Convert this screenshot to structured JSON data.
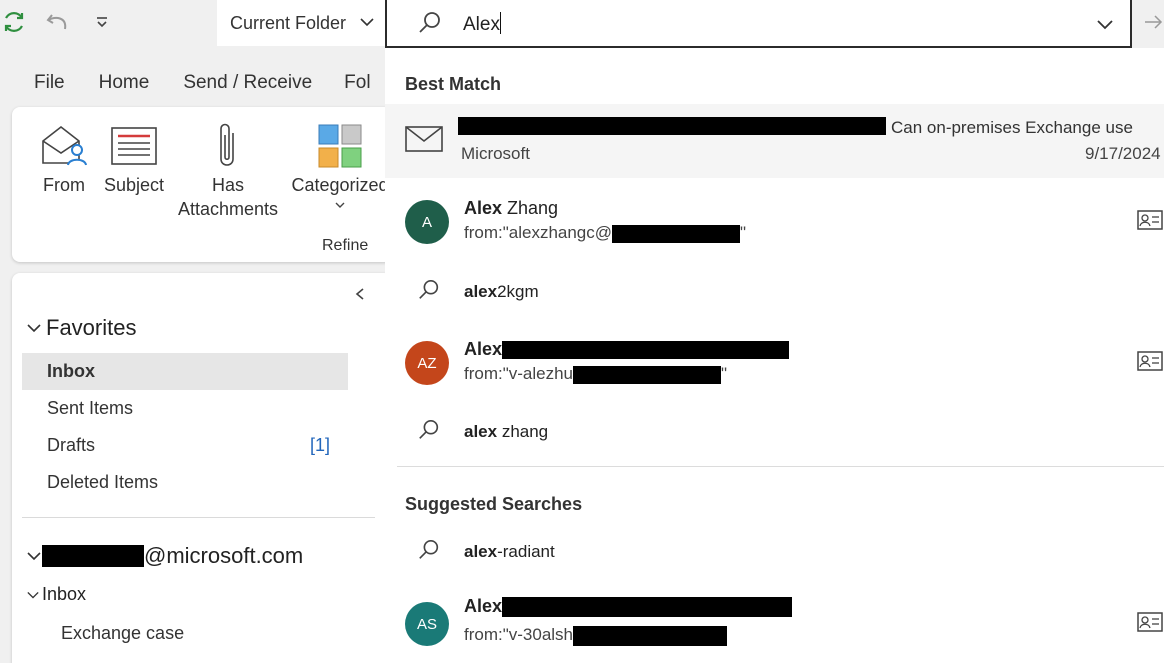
{
  "search": {
    "scope_label": "Current Folder",
    "query": "Alex"
  },
  "ribbon": {
    "tabs": [
      "File",
      "Home",
      "Send / Receive",
      "Fol"
    ],
    "buttons": [
      {
        "label": "From",
        "icon": "envelope-person-icon"
      },
      {
        "label": "Subject",
        "icon": "subject-lines-icon"
      },
      {
        "label": "Has\nAttachments",
        "icon": "paperclip-icon"
      },
      {
        "label": "Categorized",
        "icon": "categories-grid-icon"
      }
    ],
    "group_label": "Refine"
  },
  "folders": {
    "favorites_label": "Favorites",
    "favorites": [
      {
        "label": "Inbox",
        "selected": true,
        "count": ""
      },
      {
        "label": "Sent Items",
        "selected": false,
        "count": ""
      },
      {
        "label": "Drafts",
        "selected": false,
        "count": "[1]"
      },
      {
        "label": "Deleted Items",
        "selected": false,
        "count": ""
      }
    ],
    "account_suffix": "@microsoft.com",
    "account_inbox_label": "Inbox",
    "subfolder": "Exchange case"
  },
  "dropdown": {
    "best_match_label": "Best Match",
    "best_match": {
      "subject_tail": "Can on-premises Exchange use",
      "sender": "Microsoft",
      "date": "9/17/2024"
    },
    "people": [
      {
        "initials": "A",
        "color": "#1f5e4a",
        "name_bold": "Alex",
        "name_rest": " Zhang",
        "from": "from:\"alexzhangc@",
        "from_end": "\""
      },
      {
        "initials": "AZ",
        "color": "#c4461b",
        "name_bold": "Alex",
        "name_rest": "",
        "from": "from:\"v-alezhu",
        "from_end": "\""
      },
      {
        "initials": "AS",
        "color": "#1a7a77",
        "name_bold": "Alex",
        "name_rest": "",
        "from": "from:\"v-30alsh",
        "from_end": ""
      }
    ],
    "suggestions_top": [
      {
        "bold": "alex",
        "rest": "2kgm"
      },
      {
        "bold": "alex",
        "rest": " zhang"
      }
    ],
    "suggested_label": "Suggested Searches",
    "suggestions_bottom": [
      {
        "bold": "alex",
        "rest": "-radiant"
      }
    ]
  },
  "colors": {
    "accent_green": "#2f8f3f",
    "link_blue": "#2266bb"
  }
}
